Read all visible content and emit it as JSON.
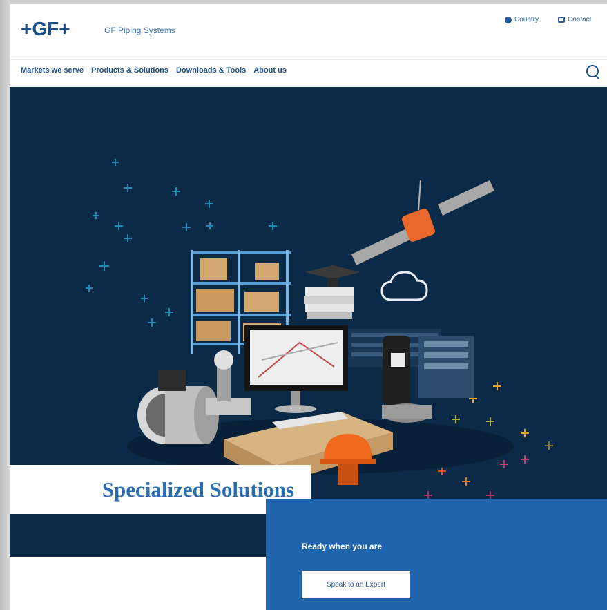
{
  "header": {
    "logo": "+GF+",
    "brand_subtitle": "GF Piping Systems",
    "utility": {
      "country_label": "Country",
      "contact_label": "Contact"
    }
  },
  "nav": {
    "items": [
      "Markets we serve",
      "Products & Solutions",
      "Downloads & Tools",
      "About us"
    ]
  },
  "hero": {
    "title": "Specialized Solutions",
    "cta_text": "Ready when you are",
    "cta_button": "Speak to an Expert"
  },
  "icons": {
    "search": "search-icon",
    "country": "globe-icon",
    "contact": "contact-icon",
    "cloud": "cloud-icon",
    "satellite": "satellite-icon"
  },
  "colors": {
    "navy": "#0b2a47",
    "brand_blue": "#2064ad",
    "title_blue": "#2a6db0"
  }
}
